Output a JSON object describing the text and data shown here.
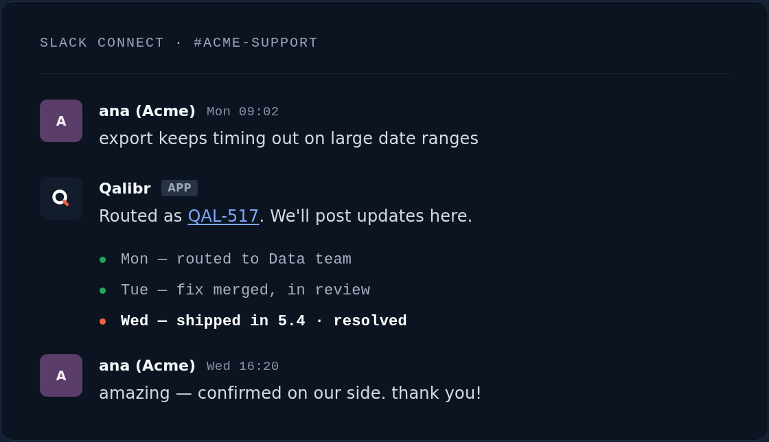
{
  "channel": {
    "title": "SLACK CONNECT · #ACME-SUPPORT"
  },
  "messages": [
    {
      "kind": "user",
      "avatar": "A",
      "author": "ana (Acme)",
      "time": "Mon 09:02",
      "text": "export keeps timing out on large date ranges"
    },
    {
      "kind": "app",
      "author": "Qalibr",
      "badge": "APP",
      "text": [
        {
          "kind": "plain",
          "text": "Routed as "
        },
        {
          "kind": "link",
          "text": "QAL-517"
        },
        {
          "kind": "plain",
          "text": ". We'll post updates here."
        }
      ],
      "updates": [
        {
          "text": "Mon — routed to Data team",
          "color": "#22a55b",
          "highlighted": false
        },
        {
          "text": "Tue — fix merged, in review",
          "color": "#22a55b",
          "highlighted": false
        },
        {
          "text": "Wed — shipped in 5.4 · resolved",
          "color": "#f0603c",
          "highlighted": true
        }
      ]
    },
    {
      "kind": "user",
      "avatar": "A",
      "author": "ana (Acme)",
      "time": "Wed 16:20",
      "text": "amazing — confirmed on our side. thank you!"
    }
  ]
}
